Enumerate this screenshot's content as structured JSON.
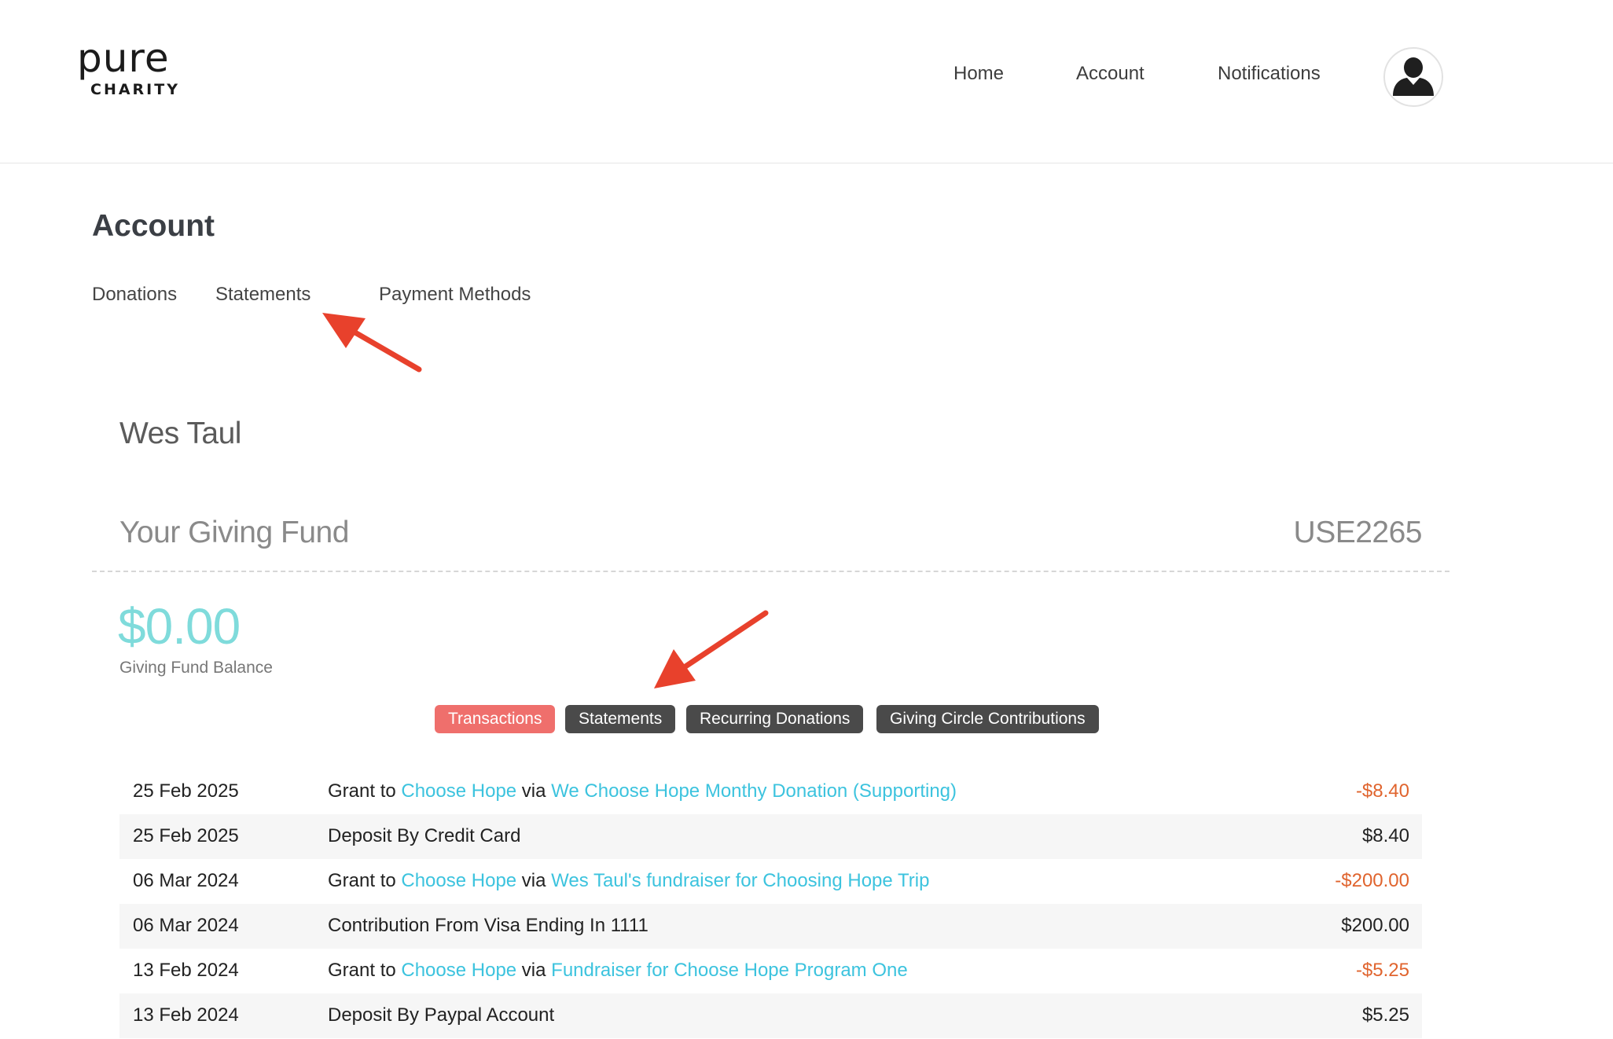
{
  "header": {
    "logo_main": "pure",
    "logo_sub": "CHARITY",
    "nav": {
      "home": "Home",
      "account": "Account",
      "notifications": "Notifications"
    },
    "avatar_icon": "user-silhouette-icon"
  },
  "account": {
    "title": "Account",
    "tabs": {
      "donations": "Donations",
      "statements": "Statements",
      "payment_methods": "Payment Methods"
    }
  },
  "fund": {
    "user_name": "Wes Taul",
    "title": "Your Giving Fund",
    "id": "USE2265",
    "balance": "$0.00",
    "balance_label": "Giving Fund Balance"
  },
  "pills": {
    "transactions": "Transactions",
    "statements": "Statements",
    "recurring": "Recurring Donations",
    "giving_circle": "Giving Circle Contributions"
  },
  "colors": {
    "accent_pill": "#ef6f6c",
    "pill_dark": "#4a4a4a",
    "link": "#3cc3de",
    "negative": "#e0642e",
    "balance": "#7fdbdb",
    "annotation_arrow": "#e8412c"
  },
  "transactions": [
    {
      "date": "25 Feb 2025",
      "prefix": "Grant to ",
      "charity": "Choose Hope",
      "via": " via ",
      "fundraiser": "We Choose Hope Monthy Donation (Supporting)",
      "amount": "-$8.40"
    },
    {
      "date": "25 Feb 2025",
      "text": "Deposit By Credit Card",
      "amount": "$8.40"
    },
    {
      "date": "06 Mar 2024",
      "prefix": "Grant to ",
      "charity": "Choose Hope",
      "via": " via ",
      "fundraiser": "Wes Taul's fundraiser for Choosing Hope Trip",
      "amount": "-$200.00"
    },
    {
      "date": "06 Mar 2024",
      "text": "Contribution From Visa Ending In 1111",
      "amount": "$200.00"
    },
    {
      "date": "13 Feb 2024",
      "prefix": "Grant to ",
      "charity": "Choose Hope",
      "via": " via ",
      "fundraiser": "Fundraiser for Choose Hope Program One",
      "amount": "-$5.25"
    },
    {
      "date": "13 Feb 2024",
      "text": "Deposit By Paypal Account",
      "amount": "$5.25"
    }
  ]
}
